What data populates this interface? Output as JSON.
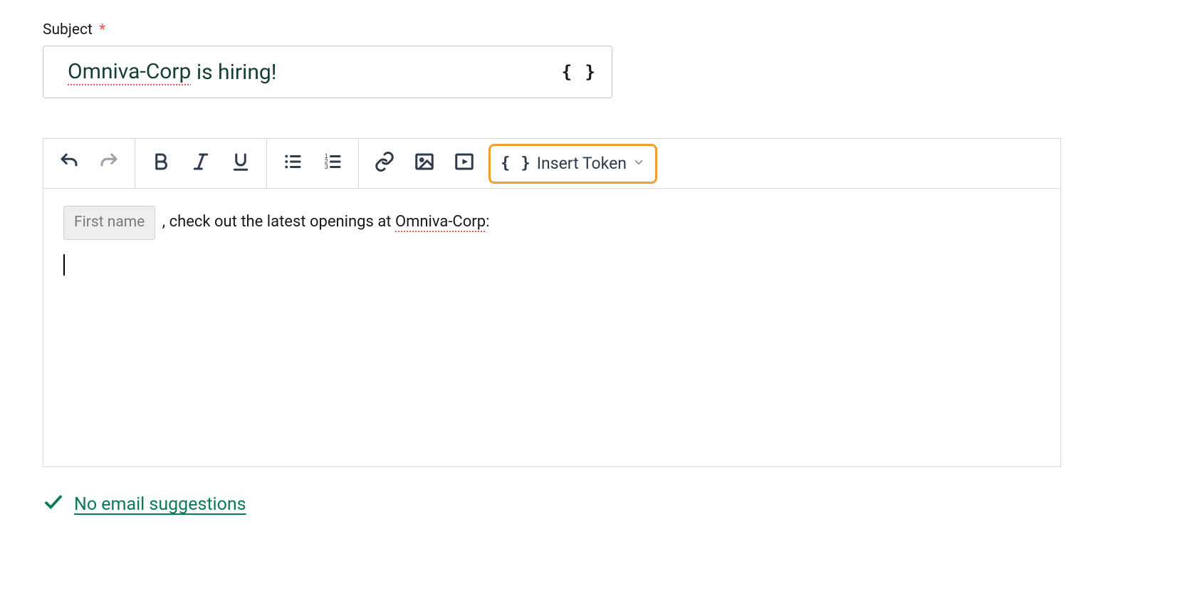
{
  "subject": {
    "label": "Subject",
    "required_marker": "*",
    "value_prefix": "Omniva-Corp",
    "value_suffix": " is hiring!",
    "token_button_glyph": "{ }"
  },
  "toolbar": {
    "insert_token_label": "Insert Token",
    "insert_token_braces": "{ }"
  },
  "body": {
    "token_chip": "First name",
    "line1_mid": " , check out the latest openings at ",
    "line1_company": "Omniva-Corp",
    "line1_tail": ":"
  },
  "suggestions": {
    "text": "No email suggestions"
  }
}
